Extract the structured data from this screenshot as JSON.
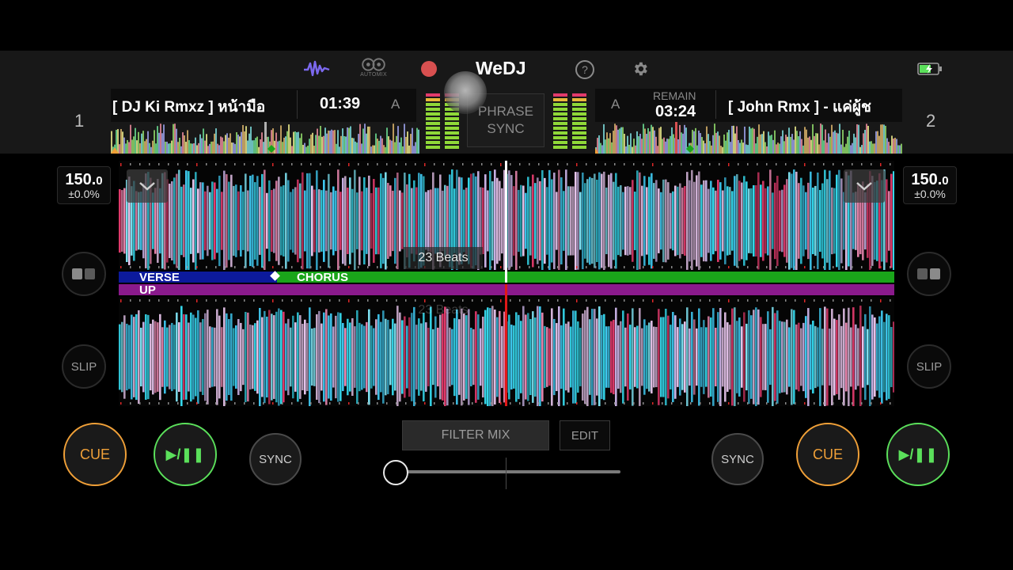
{
  "app": {
    "logo": "WeDJ"
  },
  "toolbar": {
    "waveform_icon": "waveform-icon",
    "automix_label": "AUTOMIX",
    "help_icon": "?",
    "battery_icon": "battery-charging-icon"
  },
  "colors": {
    "cue": "#f0a038",
    "play": "#5be05b",
    "verse": "#0c1a9c",
    "chorus": "#1aa51a",
    "up": "#8a1a8c",
    "playhead_top": "#ffffff",
    "playhead_bottom": "#e01818"
  },
  "phrase_sync": {
    "line1": "PHRASE",
    "line2": "SYNC"
  },
  "deck1": {
    "number": "1",
    "title": "[ DJ Ki Rmxz ] หน้ามือ",
    "time": "01:39",
    "key": "A",
    "bpm_int": "150.",
    "bpm_dec": "0",
    "pitch": "±0.0%",
    "slip": "SLIP",
    "cue": "CUE",
    "play": "▶/❚❚",
    "sync": "SYNC",
    "beats_label": "23 Beats"
  },
  "deck2": {
    "number": "2",
    "title": "[ John Rmx ] -  แค่ผู้ช",
    "remain_label": "REMAIN",
    "time": "03:24",
    "key": "A",
    "bpm_int": "150.",
    "bpm_dec": "0",
    "pitch": "±0.0%",
    "slip": "SLIP",
    "cue": "CUE",
    "play": "▶/❚❚",
    "sync": "SYNC",
    "beats_label": "23 Beats"
  },
  "sections": {
    "verse": "VERSE",
    "chorus": "CHORUS",
    "up": "UP"
  },
  "mixer": {
    "filter_mix": "FILTER MIX",
    "edit": "EDIT",
    "crossfader_position": 0.0
  }
}
